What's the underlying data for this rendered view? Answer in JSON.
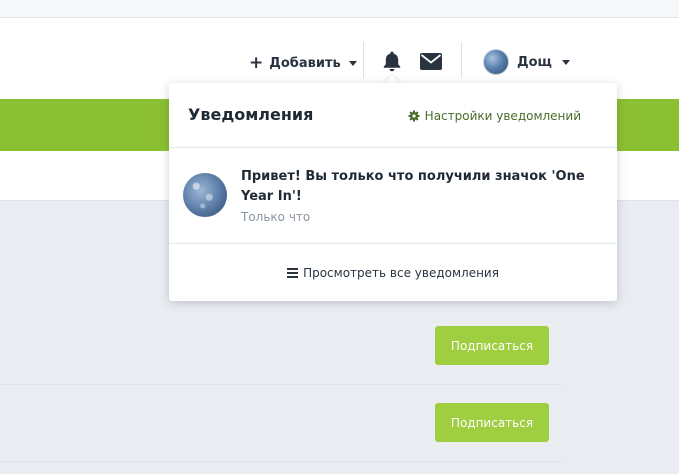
{
  "nav": {
    "add_label": "Добавить",
    "username": "Дощ"
  },
  "notifications_popup": {
    "title": "Уведомления",
    "settings_label": "Настройки уведомлений",
    "items": [
      {
        "text": "Привет! Вы только что получили значок 'One Year In'!",
        "time": "Только что"
      }
    ],
    "view_all_label": "Просмотреть все уведомления"
  },
  "content": {
    "subscribe_buttons": [
      "Подписаться",
      "Подписаться"
    ]
  },
  "colors": {
    "accent_green": "#8cc033",
    "button_green": "#9fce41"
  },
  "icons": [
    "plus-icon",
    "caret-down-icon",
    "bell-icon",
    "envelope-icon",
    "gear-icon",
    "list-icon",
    "avatar"
  ]
}
